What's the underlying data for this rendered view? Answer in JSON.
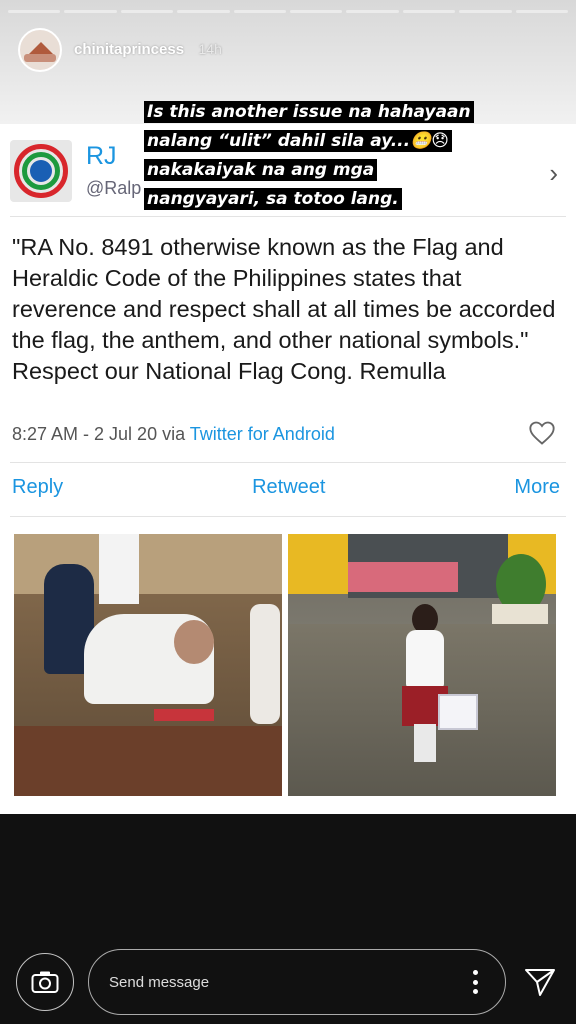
{
  "story": {
    "username": "chinitaprincess",
    "time": "14h",
    "progress_segments": 10
  },
  "caption": {
    "text": "Is this another issue na hahayaan nalang “ulit” dahil sila ay...😬😞 nakakaiyak na ang mga nangyayari, sa totoo lang."
  },
  "tweet": {
    "name": "RJ",
    "handle": "@Ralp",
    "text": "\"RA No. 8491 otherwise known as the Flag and Heraldic Code of the Philippines states that reverence and respect shall at all times be accorded the flag, the anthem, and other national symbols.\" Respect our National Flag Cong. Remulla",
    "timestamp": "8:27 AM - 2 Jul 20 via",
    "via": "Twitter for Android",
    "actions": {
      "reply": "Reply",
      "retweet": "Retweet",
      "more": "More"
    }
  },
  "bottom_bar": {
    "message_placeholder": "Send message"
  },
  "colors": {
    "twitter_blue": "#1b95e0"
  }
}
